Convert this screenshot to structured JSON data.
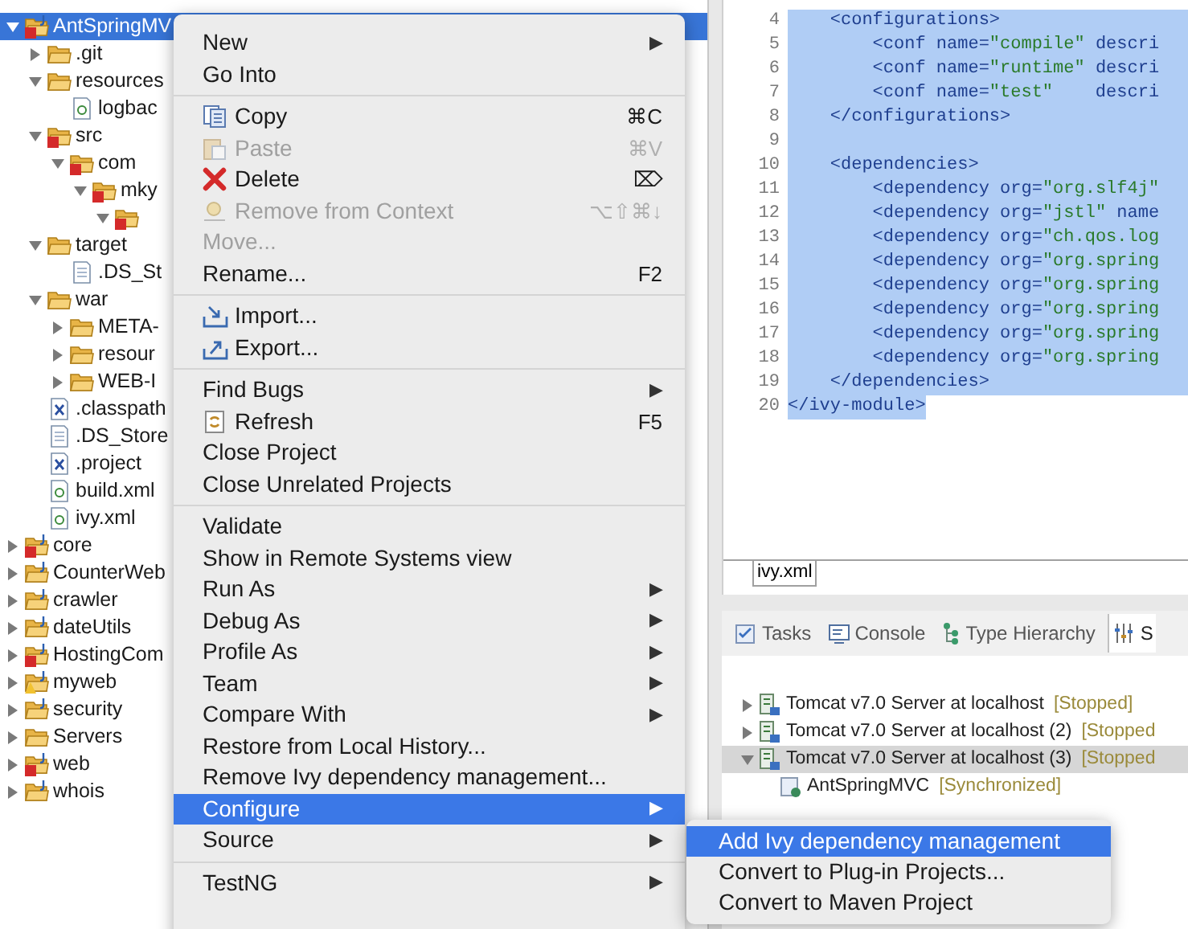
{
  "project_tree": [
    {
      "label": "AntSpringMV",
      "kind": "project",
      "error": true,
      "expanded": true,
      "selected": true,
      "children": [
        {
          "label": ".git",
          "kind": "folder",
          "expanded": false,
          "selected": false
        },
        {
          "label": "resources",
          "kind": "folder",
          "expanded": true,
          "selected": false,
          "children": [
            {
              "label": "logbac",
              "kind": "ant-file",
              "selected": false
            }
          ]
        },
        {
          "label": "src",
          "kind": "folder",
          "error": true,
          "expanded": true,
          "selected": false,
          "children": [
            {
              "label": "com",
              "kind": "folder",
              "error": true,
              "expanded": true,
              "selected": false,
              "children": [
                {
                  "label": "mky",
                  "kind": "folder",
                  "error": true,
                  "expanded": true,
                  "selected": false,
                  "children": [
                    {
                      "kind": "folder",
                      "error": true,
                      "expanded": true,
                      "selected": false
                    }
                  ]
                }
              ]
            }
          ]
        },
        {
          "label": "target",
          "kind": "folder",
          "expanded": true,
          "selected": false,
          "children": [
            {
              "label": ".DS_St",
              "kind": "text-file",
              "selected": false
            }
          ]
        },
        {
          "label": "war",
          "kind": "folder",
          "expanded": true,
          "selected": false,
          "children": [
            {
              "label": "META-",
              "kind": "folder",
              "expanded": false,
              "selected": false
            },
            {
              "label": "resour",
              "kind": "folder",
              "expanded": false,
              "selected": false
            },
            {
              "label": "WEB-I",
              "kind": "folder",
              "expanded": false,
              "selected": false
            }
          ]
        },
        {
          "label": ".classpath",
          "kind": "xml-file",
          "selected": false
        },
        {
          "label": ".DS_Store",
          "kind": "text-file",
          "selected": false
        },
        {
          "label": ".project",
          "kind": "xml-file",
          "selected": false
        },
        {
          "label": "build.xml",
          "kind": "ant-file",
          "selected": false
        },
        {
          "label": "ivy.xml",
          "kind": "ant-file",
          "selected": false
        }
      ]
    },
    {
      "label": "core",
      "kind": "project",
      "error": true,
      "expanded": false,
      "selected": false
    },
    {
      "label": "CounterWeb",
      "kind": "project",
      "expanded": false,
      "selected": false
    },
    {
      "label": "crawler",
      "kind": "project",
      "expanded": false,
      "selected": false
    },
    {
      "label": "dateUtils",
      "kind": "project",
      "expanded": false,
      "selected": false
    },
    {
      "label": "HostingCom",
      "kind": "project",
      "error": true,
      "expanded": false,
      "selected": false
    },
    {
      "label": "myweb",
      "kind": "project",
      "warning": true,
      "expanded": false,
      "selected": false
    },
    {
      "label": "security",
      "kind": "project",
      "expanded": false,
      "selected": false
    },
    {
      "label": "Servers",
      "kind": "folder",
      "expanded": false,
      "selected": false
    },
    {
      "label": "web",
      "kind": "project",
      "error": true,
      "expanded": false,
      "selected": false
    },
    {
      "label": "whois",
      "kind": "project",
      "expanded": false,
      "selected": false
    }
  ],
  "editor": {
    "lines": [
      {
        "number": "4",
        "code": "    <configurations>",
        "selected": true
      },
      {
        "number": "5",
        "code": "        <conf name=\"compile\" descri",
        "selected": true
      },
      {
        "number": "6",
        "code": "        <conf name=\"runtime\" descri",
        "selected": true
      },
      {
        "number": "7",
        "code": "        <conf name=\"test\"    descri",
        "selected": true
      },
      {
        "number": "8",
        "code": "    </configurations>",
        "selected": true
      },
      {
        "number": "9",
        "selected": true
      },
      {
        "number": "10",
        "code": "    <dependencies>",
        "selected": true
      },
      {
        "number": "11",
        "code": "        <dependency org=\"org.slf4j\"",
        "selected": true
      },
      {
        "number": "12",
        "code": "        <dependency org=\"jstl\" name",
        "selected": true
      },
      {
        "number": "13",
        "code": "        <dependency org=\"ch.qos.log",
        "selected": true
      },
      {
        "number": "14",
        "code": "        <dependency org=\"org.spring",
        "selected": true
      },
      {
        "number": "15",
        "code": "        <dependency org=\"org.spring",
        "selected": true
      },
      {
        "number": "16",
        "code": "        <dependency org=\"org.spring",
        "selected": true
      },
      {
        "number": "17",
        "code": "        <dependency org=\"org.spring",
        "selected": true
      },
      {
        "number": "18",
        "code": "        <dependency org=\"org.spring",
        "selected": true
      },
      {
        "number": "19",
        "code": "    </dependencies>",
        "selected": true
      },
      {
        "number": "20",
        "code": "</ivy-module>",
        "selected": true
      }
    ],
    "tab": "ivy.xml"
  },
  "bottom_panel": {
    "tabs": [
      {
        "label": "Tasks",
        "kind": "tasks",
        "selected": false
      },
      {
        "label": "Console",
        "kind": "console",
        "selected": false
      },
      {
        "label": "Type Hierarchy",
        "kind": "hierarchy",
        "selected": false
      },
      {
        "label": "S",
        "kind": "servers",
        "selected": true
      }
    ],
    "servers": [
      {
        "name": "Tomcat v7.0 Server at localhost",
        "status": "[Stopped]",
        "expanded": false,
        "selected": false
      },
      {
        "name": "Tomcat v7.0 Server at localhost (2)",
        "status": "[Stopped",
        "expanded": false,
        "selected": false
      },
      {
        "name": "Tomcat v7.0 Server at localhost (3)",
        "status": "[Stopped",
        "expanded": true,
        "selected": true,
        "children": [
          {
            "name": "AntSpringMVC",
            "status": "[Synchronized]"
          }
        ]
      }
    ]
  },
  "context_menu": {
    "groups": [
      [
        {
          "label": "New",
          "submenu": true,
          "disabled": false,
          "selected": false
        },
        {
          "label": "Go Into",
          "submenu": false,
          "disabled": false,
          "selected": false
        }
      ],
      [
        {
          "label": "Copy",
          "kind": "copy",
          "shortcut": "⌘C",
          "submenu": false,
          "disabled": false,
          "selected": false
        },
        {
          "label": "Paste",
          "kind": "paste",
          "shortcut": "⌘V",
          "submenu": false,
          "disabled": true,
          "selected": false
        },
        {
          "label": "Delete",
          "kind": "delete",
          "shortcut": "⌦",
          "submenu": false,
          "disabled": false,
          "selected": false
        },
        {
          "label": "Remove from Context",
          "kind": "remove",
          "shortcut": "⌥⇧⌘↓",
          "submenu": false,
          "disabled": true,
          "selected": false
        },
        {
          "label": "Move...",
          "submenu": false,
          "disabled": true,
          "selected": false
        },
        {
          "label": "Rename...",
          "shortcut": "F2",
          "submenu": false,
          "disabled": false,
          "selected": false
        }
      ],
      [
        {
          "label": "Import...",
          "kind": "import",
          "submenu": false,
          "disabled": false,
          "selected": false
        },
        {
          "label": "Export...",
          "kind": "export",
          "submenu": false,
          "disabled": false,
          "selected": false
        }
      ],
      [
        {
          "label": "Find Bugs",
          "submenu": true,
          "disabled": false,
          "selected": false
        },
        {
          "label": "Refresh",
          "kind": "refresh",
          "shortcut": "F5",
          "submenu": false,
          "disabled": false,
          "selected": false
        },
        {
          "label": "Close Project",
          "submenu": false,
          "disabled": false,
          "selected": false
        },
        {
          "label": "Close Unrelated Projects",
          "submenu": false,
          "disabled": false,
          "selected": false
        }
      ],
      [
        {
          "label": "Validate",
          "submenu": false,
          "disabled": false,
          "selected": false
        },
        {
          "label": "Show in Remote Systems view",
          "submenu": false,
          "disabled": false,
          "selected": false
        },
        {
          "label": "Run As",
          "submenu": true,
          "disabled": false,
          "selected": false
        },
        {
          "label": "Debug As",
          "submenu": true,
          "disabled": false,
          "selected": false
        },
        {
          "label": "Profile As",
          "submenu": true,
          "disabled": false,
          "selected": false
        },
        {
          "label": "Team",
          "submenu": true,
          "disabled": false,
          "selected": false
        },
        {
          "label": "Compare With",
          "submenu": true,
          "disabled": false,
          "selected": false
        },
        {
          "label": "Restore from Local History...",
          "submenu": false,
          "disabled": false,
          "selected": false
        },
        {
          "label": "Remove Ivy dependency management...",
          "submenu": false,
          "disabled": false,
          "selected": false
        },
        {
          "label": "Configure",
          "submenu": true,
          "disabled": false,
          "selected": true
        },
        {
          "label": "Source",
          "submenu": true,
          "disabled": false,
          "selected": false
        }
      ],
      [
        {
          "label": "TestNG",
          "submenu": true,
          "disabled": false,
          "selected": false
        }
      ]
    ],
    "arrow": "▶"
  },
  "submenu": {
    "items": [
      {
        "label": "Add Ivy dependency management",
        "selected": true
      },
      {
        "label": "Convert to Plug-in Projects...",
        "selected": false
      },
      {
        "label": "Convert to Maven Project",
        "selected": false
      }
    ]
  }
}
